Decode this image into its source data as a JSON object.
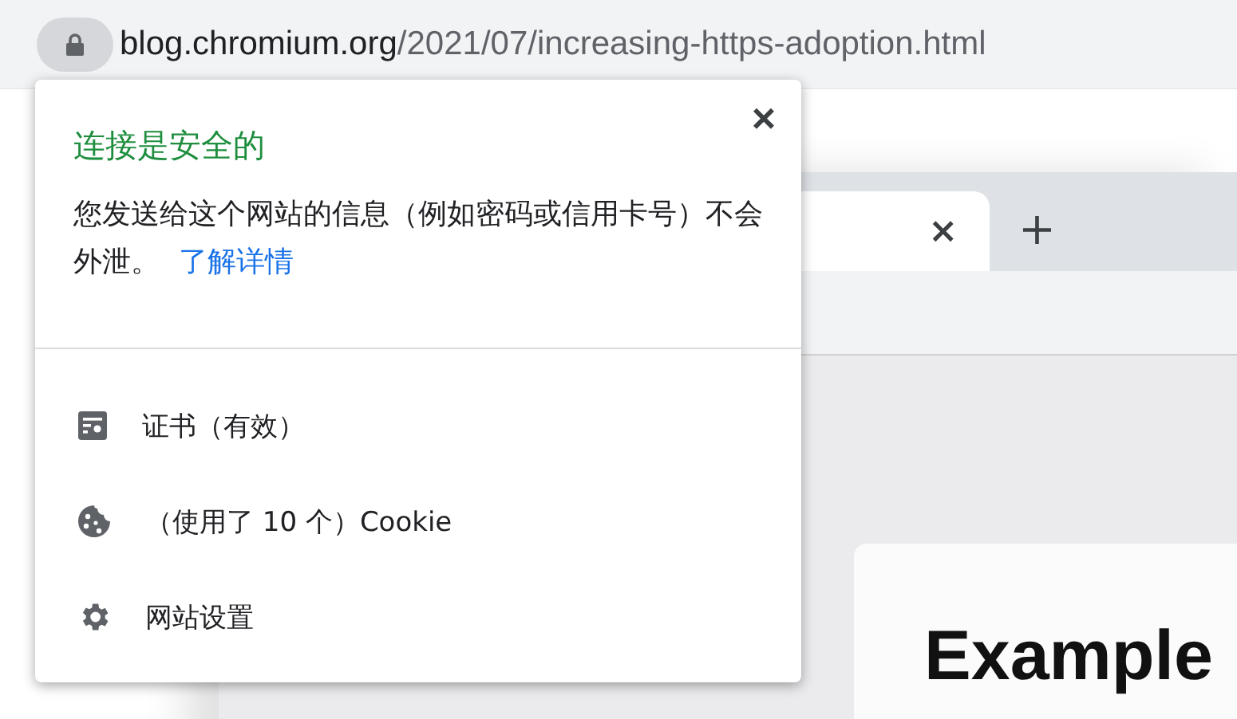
{
  "address_bar": {
    "secure": true,
    "host": "blog.chromium.org",
    "path": "/2021/07/increasing-https-adoption.html"
  },
  "background_page": {
    "tab_close": "×",
    "new_tab": "+",
    "heading": "Example"
  },
  "popup": {
    "title": "连接是安全的",
    "close": "×",
    "description": "您发送给这个网站的信息（例如密码或信用卡号）不会外泄。",
    "link": "了解详情",
    "items": [
      {
        "kind": "certificate",
        "label": "证书（有效）"
      },
      {
        "kind": "cookie",
        "label": "（使用了 10 个）Cookie"
      },
      {
        "kind": "settings",
        "label": "网站设置"
      }
    ]
  }
}
